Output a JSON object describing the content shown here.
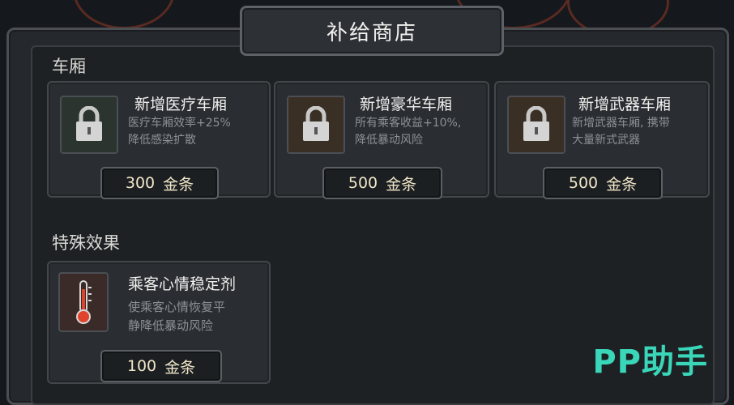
{
  "header": {
    "title": "补给商店"
  },
  "sections": {
    "carriages": {
      "label": "车厢",
      "items": [
        {
          "name": "新增医疗车厢",
          "desc_line1": "医疗车厢效率+25%",
          "desc_line2": "降低感染扩散",
          "price": "300",
          "currency": "金条",
          "icon": "padlock-icon"
        },
        {
          "name": "新增豪华车厢",
          "desc_line1": "所有乘客收益+10%,",
          "desc_line2": "降低暴动风险",
          "price": "500",
          "currency": "金条",
          "icon": "padlock-icon"
        },
        {
          "name": "新增武器车厢",
          "desc_line1": "新增武器车厢, 携带",
          "desc_line2": "大量新式武器",
          "price": "500",
          "currency": "金条",
          "icon": "padlock-icon"
        }
      ]
    },
    "effects": {
      "label": "特殊效果",
      "items": [
        {
          "name": "乘客心情稳定剂",
          "desc_line1": "使乘客心情恢复平",
          "desc_line2": "静降低暴动风险",
          "price": "100",
          "currency": "金条",
          "icon": "thermometer-icon"
        }
      ]
    }
  },
  "watermark": "PP助手",
  "colors": {
    "accent_gold": "#f0e6c8",
    "watermark": "#39d6b9",
    "thermometer": "#e0442c"
  }
}
